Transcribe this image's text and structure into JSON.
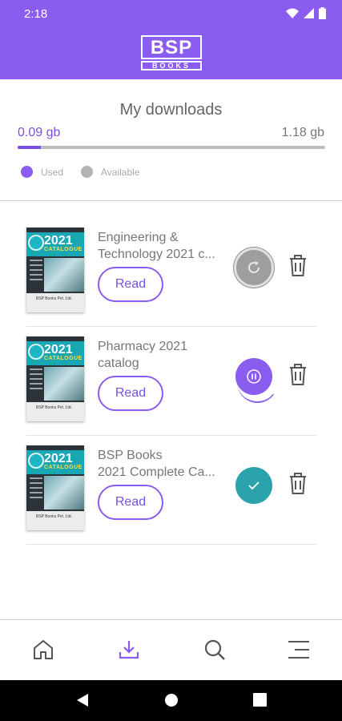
{
  "status_bar": {
    "time": "2:18"
  },
  "app": {
    "logo_top": "BSP",
    "logo_bottom": "BOOKS"
  },
  "storage": {
    "heading": "My downloads",
    "used": "0.09 gb",
    "total": "1.18 gb",
    "used_fraction": 0.076,
    "legend": [
      {
        "label": "Used",
        "color": "#8a5cf0"
      },
      {
        "label": "Available",
        "color": "#b3b3b3"
      }
    ]
  },
  "downloads": [
    {
      "title_line1": "Engineering &",
      "title_line2": "Technology 2021 c...",
      "read_label": "Read",
      "status": "refresh",
      "cover": {
        "year": "2021",
        "label": "CATALOGUE",
        "publisher": "BSP Books Pvt. Ltd."
      }
    },
    {
      "title_line1": "Pharmacy 2021",
      "title_line2": "catalog",
      "read_label": "Read",
      "status": "paused",
      "cover": {
        "year": "2021",
        "label": "CATALOGUE",
        "publisher": "BSP Books Pvt. Ltd."
      }
    },
    {
      "title_line1": "BSP Books",
      "title_line2": "2021 Complete Ca...",
      "read_label": "Read",
      "status": "completed",
      "cover": {
        "year": "2021",
        "label": "CATALOGUE",
        "publisher": "BSP Books Pvt. Ltd."
      }
    }
  ],
  "bottom_nav": [
    {
      "icon": "home-icon",
      "active": false
    },
    {
      "icon": "download-icon",
      "active": true
    },
    {
      "icon": "search-icon",
      "active": false
    },
    {
      "icon": "menu-icon",
      "active": false
    }
  ],
  "colors": {
    "primary": "#8a5cf0",
    "completed": "#2aa3ad",
    "neutral": "#9e9e9e"
  }
}
